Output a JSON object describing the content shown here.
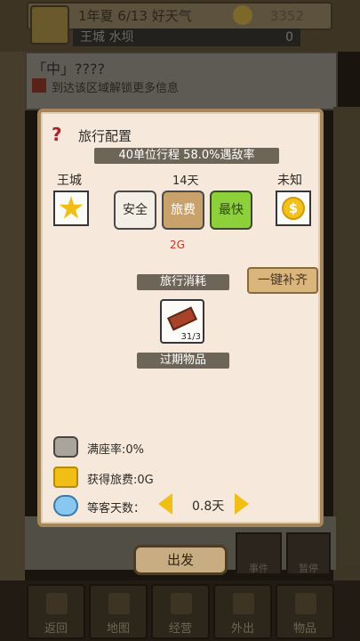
{
  "header": {
    "date": "1年夏 6/13 好天气",
    "coins": "3352",
    "location": "王城 水坝",
    "location_value": "0"
  },
  "info_card": {
    "title": "「中」????",
    "subtitle": "到达该区域解锁更多信息"
  },
  "modal": {
    "title": "旅行配置",
    "trip_stat": "40单位行程  58.0%遇敌率",
    "origin": "王城",
    "days": "14天",
    "destination": "未知",
    "options": {
      "safe": "安全",
      "fee": "旅费",
      "fast": "最快"
    },
    "fee_note": "2G",
    "consumption_tag": "旅行消耗",
    "refill_button": "一键补齐",
    "item_count": "31/3",
    "expired_tag": "过期物品",
    "stats": {
      "seat_rate": "满座率:0%",
      "fee_gain": "获得旅费:0G",
      "wait_label": "等客天数：",
      "wait_value": "0.8天"
    }
  },
  "background": {
    "event_label": "事件",
    "pause_label": "暂停"
  },
  "depart_button": "出发",
  "bottom_nav": [
    {
      "label": "返回"
    },
    {
      "label": "地图"
    },
    {
      "label": "经营"
    },
    {
      "label": "外出"
    },
    {
      "label": "物品"
    }
  ],
  "colors": {
    "panel_bg": "#f6e9dc",
    "panel_border": "#a6875b",
    "gold": "#f0be14",
    "fast_green": "#8ed03a"
  }
}
